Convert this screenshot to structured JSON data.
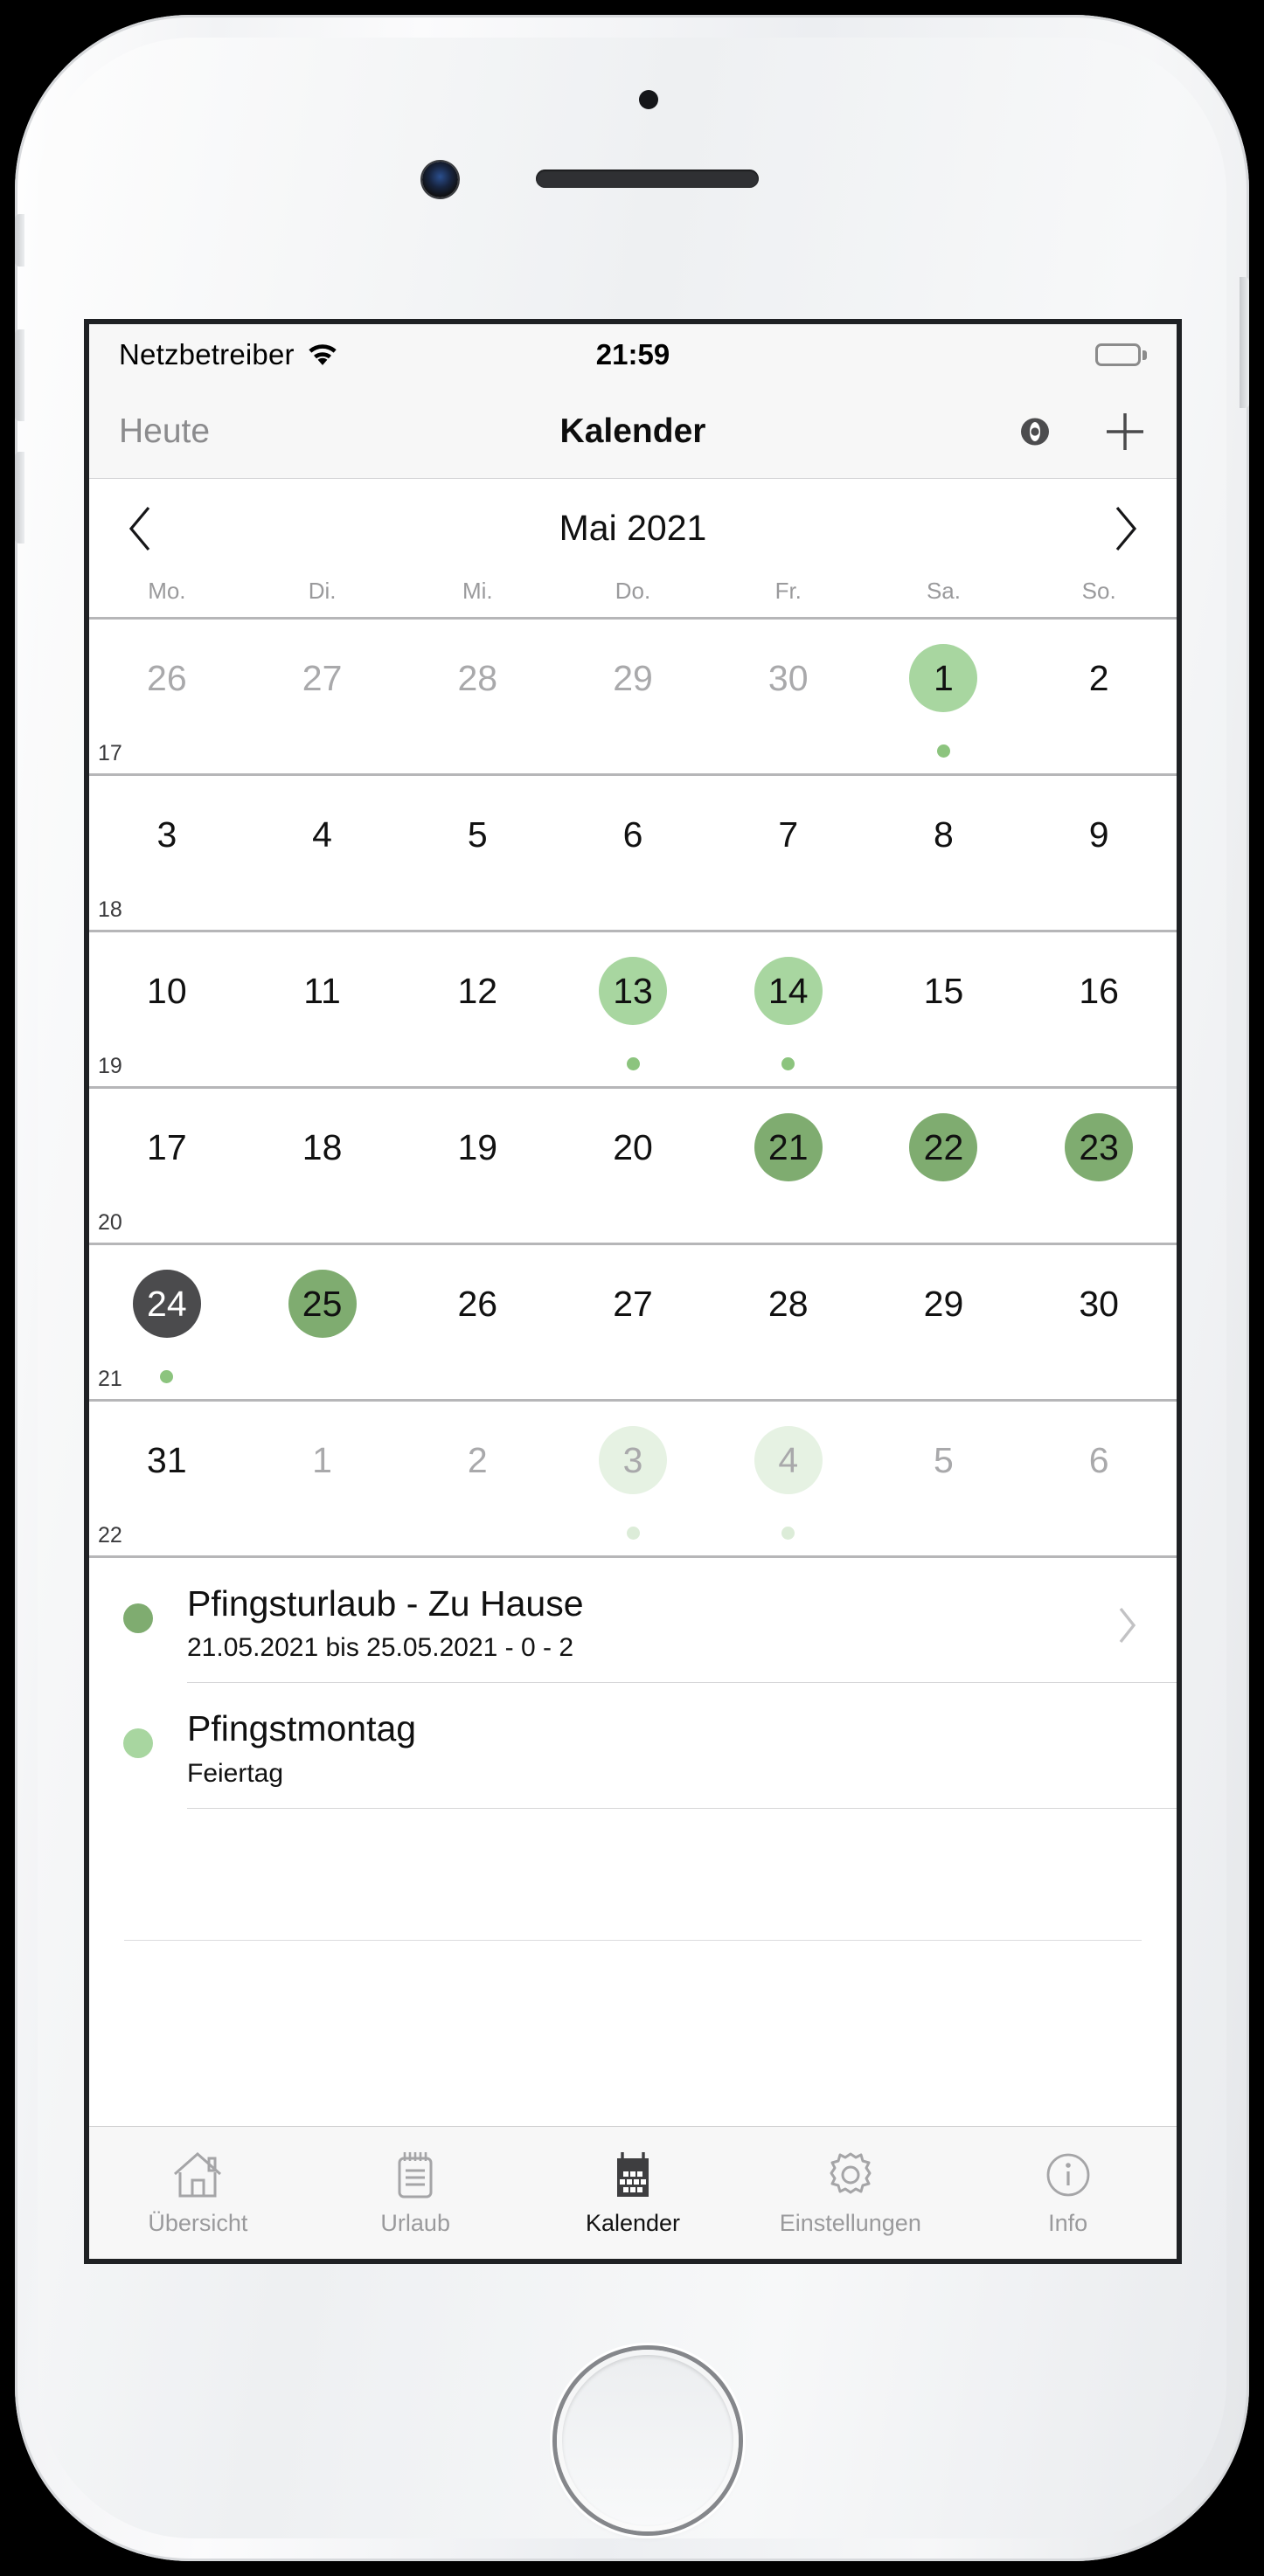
{
  "device": {
    "name": "iphone-mockup",
    "home_button": "home-button"
  },
  "status_bar": {
    "carrier": "Netzbetreiber",
    "wifi_icon": "wifi-icon",
    "time": "21:59",
    "battery_icon": "battery-full-icon"
  },
  "nav_bar": {
    "left_label": "Heute",
    "title": "Kalender",
    "eye_icon": "eye-icon",
    "add_icon": "plus-icon"
  },
  "month_header": {
    "prev_icon": "chevron-left-icon",
    "title": "Mai 2021",
    "next_icon": "chevron-right-icon"
  },
  "weekdays": [
    "Mo.",
    "Di.",
    "Mi.",
    "Do.",
    "Fr.",
    "Sa.",
    "So."
  ],
  "colors": {
    "green_light": "#a8d6a0",
    "green_medium": "#7fac70",
    "green_pale": "#e6f2e3",
    "today_gray": "#4b4b4d",
    "dot_green": "#8cc47e",
    "dot_pale": "#dcecd8",
    "text_dim": "#a9a9ab"
  },
  "calendar": {
    "weeks": [
      {
        "kw": "17",
        "days": [
          {
            "num": "26",
            "style": "dim"
          },
          {
            "num": "27",
            "style": "dim"
          },
          {
            "num": "28",
            "style": "dim"
          },
          {
            "num": "29",
            "style": "dim"
          },
          {
            "num": "30",
            "style": "dim"
          },
          {
            "num": "1",
            "style": "green-light",
            "dot": "green"
          },
          {
            "num": "2",
            "style": "plain"
          }
        ]
      },
      {
        "kw": "18",
        "days": [
          {
            "num": "3",
            "style": "plain"
          },
          {
            "num": "4",
            "style": "plain"
          },
          {
            "num": "5",
            "style": "plain"
          },
          {
            "num": "6",
            "style": "plain"
          },
          {
            "num": "7",
            "style": "plain"
          },
          {
            "num": "8",
            "style": "plain"
          },
          {
            "num": "9",
            "style": "plain"
          }
        ]
      },
      {
        "kw": "19",
        "days": [
          {
            "num": "10",
            "style": "plain"
          },
          {
            "num": "11",
            "style": "plain"
          },
          {
            "num": "12",
            "style": "plain"
          },
          {
            "num": "13",
            "style": "green-light",
            "dot": "green"
          },
          {
            "num": "14",
            "style": "green-light",
            "dot": "green"
          },
          {
            "num": "15",
            "style": "plain"
          },
          {
            "num": "16",
            "style": "plain"
          }
        ]
      },
      {
        "kw": "20",
        "days": [
          {
            "num": "17",
            "style": "plain"
          },
          {
            "num": "18",
            "style": "plain"
          },
          {
            "num": "19",
            "style": "plain"
          },
          {
            "num": "20",
            "style": "plain"
          },
          {
            "num": "21",
            "style": "green-medium"
          },
          {
            "num": "22",
            "style": "green-medium"
          },
          {
            "num": "23",
            "style": "green-medium"
          }
        ]
      },
      {
        "kw": "21",
        "days": [
          {
            "num": "24",
            "style": "today",
            "dot": "green"
          },
          {
            "num": "25",
            "style": "green-medium"
          },
          {
            "num": "26",
            "style": "plain"
          },
          {
            "num": "27",
            "style": "plain"
          },
          {
            "num": "28",
            "style": "plain"
          },
          {
            "num": "29",
            "style": "plain"
          },
          {
            "num": "30",
            "style": "plain"
          }
        ]
      },
      {
        "kw": "22",
        "days": [
          {
            "num": "31",
            "style": "plain"
          },
          {
            "num": "1",
            "style": "dim"
          },
          {
            "num": "2",
            "style": "dim"
          },
          {
            "num": "3",
            "style": "green-pale",
            "dot": "pale"
          },
          {
            "num": "4",
            "style": "green-pale",
            "dot": "pale"
          },
          {
            "num": "5",
            "style": "dim"
          },
          {
            "num": "6",
            "style": "dim"
          }
        ]
      }
    ]
  },
  "events": [
    {
      "title": "Pfingsturlaub - Zu Hause",
      "subtitle": "21.05.2021 bis 25.05.2021 - 0 - 2",
      "dot_color": "#7fac70",
      "has_chevron": true
    },
    {
      "title": "Pfingstmontag",
      "subtitle": "Feiertag",
      "dot_color": "#a8d6a0",
      "has_chevron": false
    }
  ],
  "tab_bar": {
    "items": [
      {
        "label": "Übersicht",
        "icon": "house-icon",
        "active": false
      },
      {
        "label": "Urlaub",
        "icon": "notepad-icon",
        "active": false
      },
      {
        "label": "Kalender",
        "icon": "calendar-icon",
        "active": true
      },
      {
        "label": "Einstellungen",
        "icon": "gear-icon",
        "active": false
      },
      {
        "label": "Info",
        "icon": "info-icon",
        "active": false
      }
    ]
  }
}
